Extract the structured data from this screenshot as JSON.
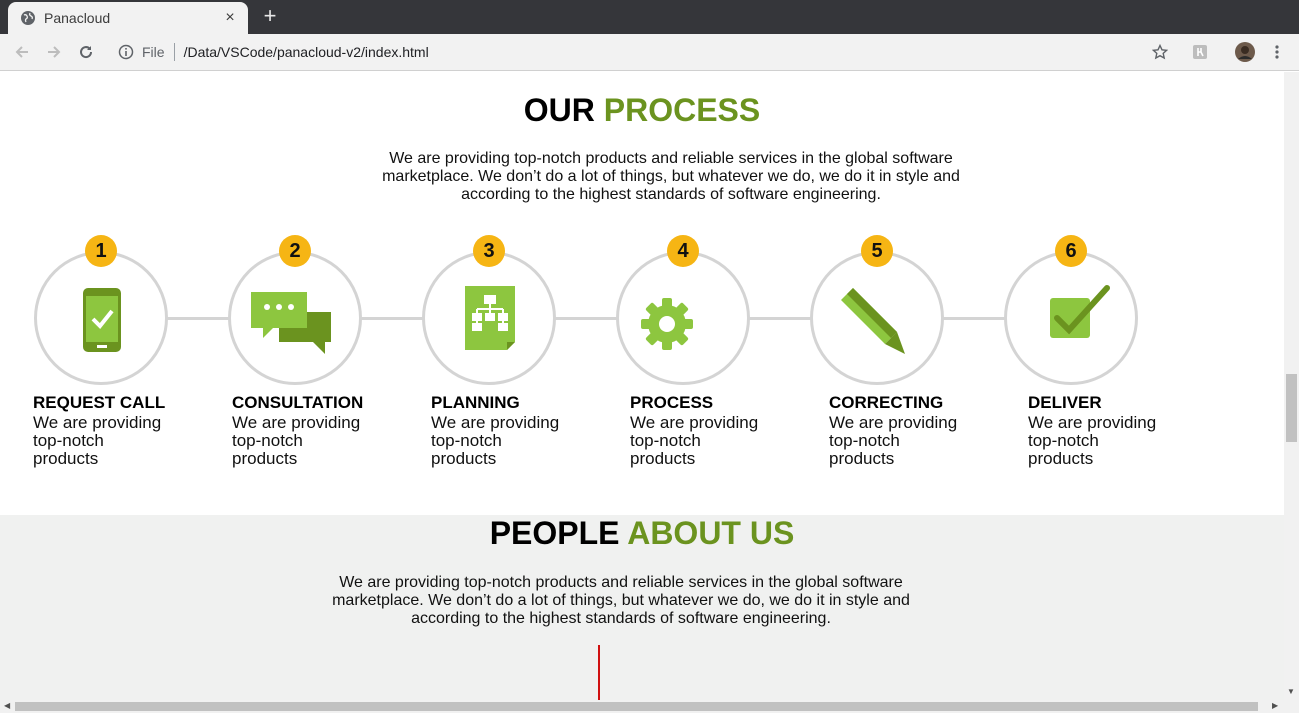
{
  "browser": {
    "tab_title": "Panacloud",
    "tab_close": "×",
    "new_tab": "+",
    "file_label": "File",
    "url": "/Data/VSCode/panacloud-v2/index.html"
  },
  "process": {
    "title_part1": "OUR",
    "title_part2": "PROCESS",
    "description": "We are providing top-notch products and reliable services in the global software marketplace. We don’t do a lot of things, but whatever we do, we do it in style and according to the highest standards of software engineering.",
    "steps": [
      {
        "number": "1",
        "title": "REQUEST CALL",
        "text": "We are providing top-notch products",
        "icon": "phone-check-icon"
      },
      {
        "number": "2",
        "title": "CONSULTATION",
        "text": "We are providing top-notch products",
        "icon": "chat-bubbles-icon"
      },
      {
        "number": "3",
        "title": "PLANNING",
        "text": "We are providing top-notch products",
        "icon": "sitemap-document-icon"
      },
      {
        "number": "4",
        "title": "PROCESS",
        "text": "We are providing top-notch products",
        "icon": "gear-icon"
      },
      {
        "number": "5",
        "title": "CORRECTING",
        "text": "We are providing top-notch products",
        "icon": "pencil-icon"
      },
      {
        "number": "6",
        "title": "DELIVER",
        "text": "We are providing top-notch products",
        "icon": "checkbox-icon"
      }
    ]
  },
  "people": {
    "title_part1": "PEOPLE",
    "title_part2": "ABOUT US",
    "description": "We are providing top-notch products and reliable services in the global software marketplace. We don’t do a lot of things, but whatever we do, we do it in style and according to the highest standards of software engineering."
  },
  "colors": {
    "accent_green": "#6b931f",
    "icon_green": "#8dc63f",
    "badge_yellow": "#f6b514",
    "circle_border": "#d4d4d4",
    "people_bg": "#f0f1f0"
  }
}
